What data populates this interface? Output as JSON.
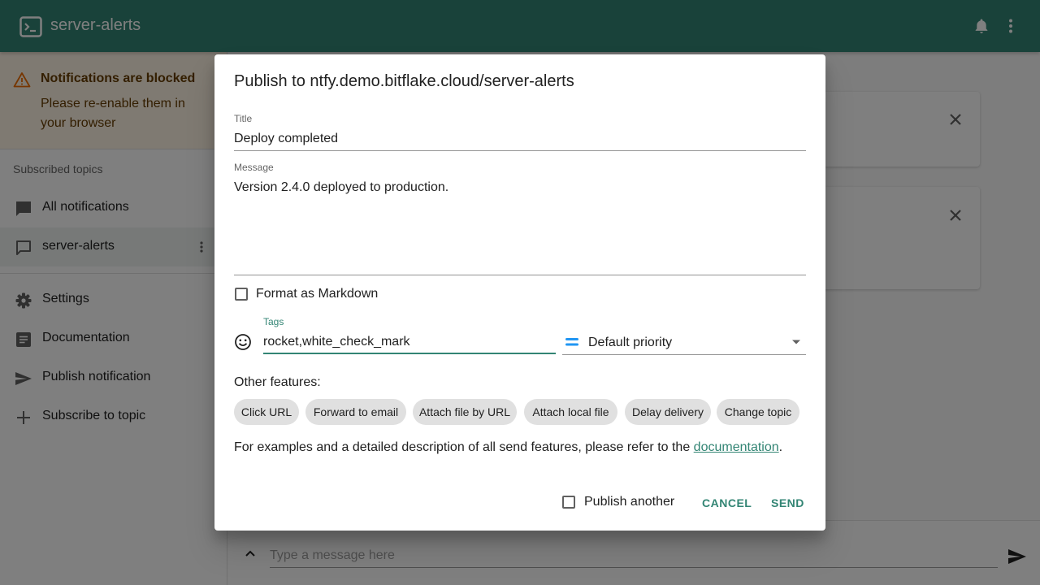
{
  "appbar": {
    "title": "server-alerts",
    "logo_icon": "terminal-icon",
    "bell_icon": "bell-icon",
    "more_icon": "more-vert-icon",
    "color": "#338574"
  },
  "sidebar": {
    "alert": {
      "title": "Notifications are blocked",
      "description": "Please re-enable them in your browser"
    },
    "subscribed_heading": "Subscribed topics",
    "items": [
      {
        "label": "All notifications",
        "icon": "chat-icon"
      },
      {
        "label": "server-alerts",
        "icon": "chat-outline-icon"
      },
      {
        "label": "Settings",
        "icon": "gear-icon"
      },
      {
        "label": "Documentation",
        "icon": "document-icon"
      },
      {
        "label": "Publish notification",
        "icon": "send-icon"
      },
      {
        "label": "Subscribe to topic",
        "icon": "plus-icon"
      }
    ]
  },
  "bottombar": {
    "placeholder": "Type a message here"
  },
  "dialog": {
    "title": "Publish to ntfy.demo.bitflake.cloud/server-alerts",
    "title_label": "Title",
    "title_value": "Deploy completed",
    "message_label": "Message",
    "message_value": "Version 2.4.0 deployed to production.",
    "markdown_label": "Format as Markdown",
    "tags_label": "Tags",
    "tags_value": "rocket,white_check_mark",
    "priority_value": "Default priority",
    "other_features_label": "Other features:",
    "chips": [
      "Click URL",
      "Forward to email",
      "Attach file by URL",
      "Attach local file",
      "Delay delivery",
      "Change topic"
    ],
    "docs_text": "For examples and a detailed description of all send features, please refer to the",
    "docs_link": "documentation",
    "docs_suffix": ".",
    "publish_another_label": "Publish another",
    "cancel_label": "CANCEL",
    "send_label": "SEND",
    "accent": "#338574"
  }
}
